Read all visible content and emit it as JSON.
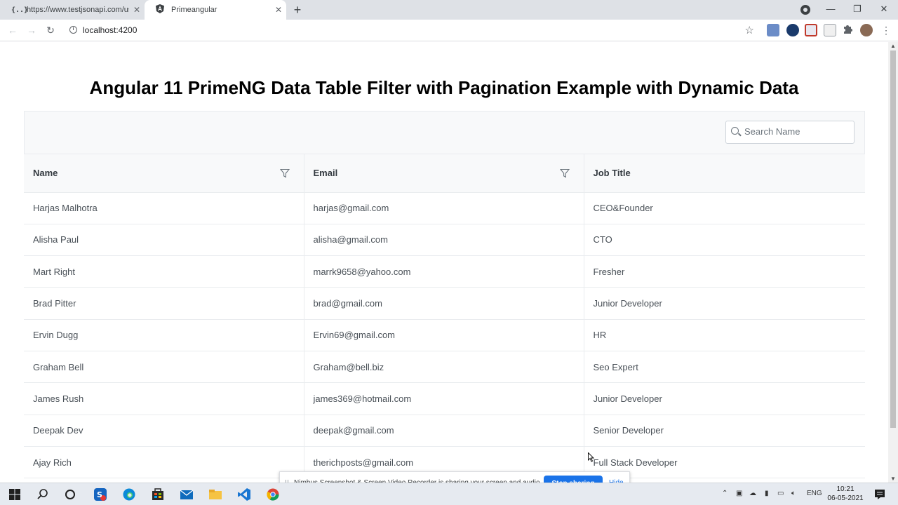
{
  "browser": {
    "tabs": [
      {
        "favicon": "{..}",
        "title": "https://www.testjsonapi.com/use",
        "active": false
      },
      {
        "favicon": "A",
        "title": "Primeangular",
        "active": true
      }
    ],
    "url": "localhost:4200"
  },
  "page": {
    "heading": "Angular 11 PrimeNG Data Table Filter with Pagination Example with Dynamic Data",
    "search_placeholder": "Search Name",
    "columns": [
      "Name",
      "Email",
      "Job Title"
    ],
    "rows": [
      {
        "name": "Harjas Malhotra",
        "email": "harjas@gmail.com",
        "job": "CEO&Founder"
      },
      {
        "name": "Alisha Paul",
        "email": "alisha@gmail.com",
        "job": "CTO"
      },
      {
        "name": "Mart Right",
        "email": "marrk9658@yahoo.com",
        "job": "Fresher"
      },
      {
        "name": "Brad Pitter",
        "email": "brad@gmail.com",
        "job": "Junior Developer"
      },
      {
        "name": "Ervin Dugg",
        "email": "Ervin69@gmail.com",
        "job": "HR"
      },
      {
        "name": "Graham Bell",
        "email": "Graham@bell.biz",
        "job": "Seo Expert"
      },
      {
        "name": "James Rush",
        "email": "james369@hotmail.com",
        "job": "Junior Developer"
      },
      {
        "name": "Deepak Dev",
        "email": "deepak@gmail.com",
        "job": "Senior Developer"
      },
      {
        "name": "Ajay Rich",
        "email": "therichposts@gmail.com",
        "job": "Full Stack Developer"
      }
    ]
  },
  "notification": {
    "message": "Nimbus Screenshot & Screen Video Recorder is sharing your screen and audio.",
    "stop_label": "Stop sharing",
    "hide_label": "Hide"
  },
  "taskbar": {
    "language": "ENG",
    "time": "10:21",
    "date": "06-05-2021"
  },
  "colors": {
    "accent": "#1a73e8",
    "table_header_bg": "#f8f9fa",
    "border": "#e9ecef"
  }
}
